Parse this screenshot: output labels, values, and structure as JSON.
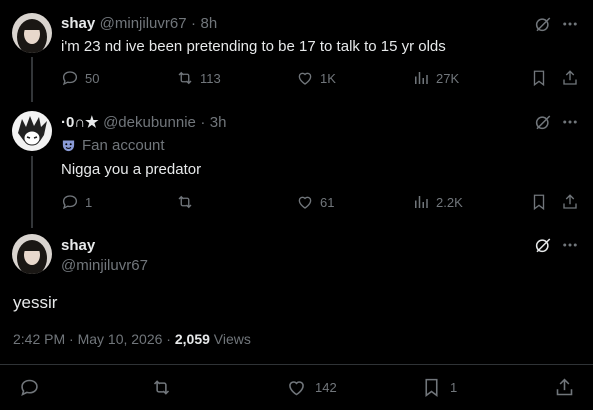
{
  "tweets": [
    {
      "name": "shay",
      "handle": "@minjiluvr67",
      "time": "8h",
      "text": "i'm 23 nd ive been pretending to be 17 to talk to 15 yr olds",
      "replies": "50",
      "retweets": "113",
      "likes": "1K",
      "views": "27K"
    },
    {
      "name": "·0∩★",
      "handle": "@dekubunnie",
      "time": "3h",
      "badge": "Fan account",
      "text": "Nigga you a predator",
      "replies": "1",
      "retweets": "",
      "likes": "61",
      "views": "2.2K"
    }
  ],
  "focused": {
    "name": "shay",
    "handle": "@minjiluvr67",
    "text": "yessir",
    "timestamp": "2:42 PM · May 10, 2026 ·",
    "views_count": "2,059",
    "views_label": "Views",
    "likes": "142",
    "bookmarks": "1"
  },
  "separator": "·",
  "icons": {
    "reply": "reply-icon",
    "retweet": "retweet-icon",
    "like": "heart-icon",
    "views": "views-icon",
    "bookmark": "bookmark-icon",
    "share": "share-icon",
    "grok": "grok-icon",
    "more": "more-icon",
    "badge": "theater-mask-icon"
  },
  "colors": {
    "background": "#000000",
    "text": "#e7e9ea",
    "muted": "#71767b",
    "badge": "#8a9bd6"
  }
}
